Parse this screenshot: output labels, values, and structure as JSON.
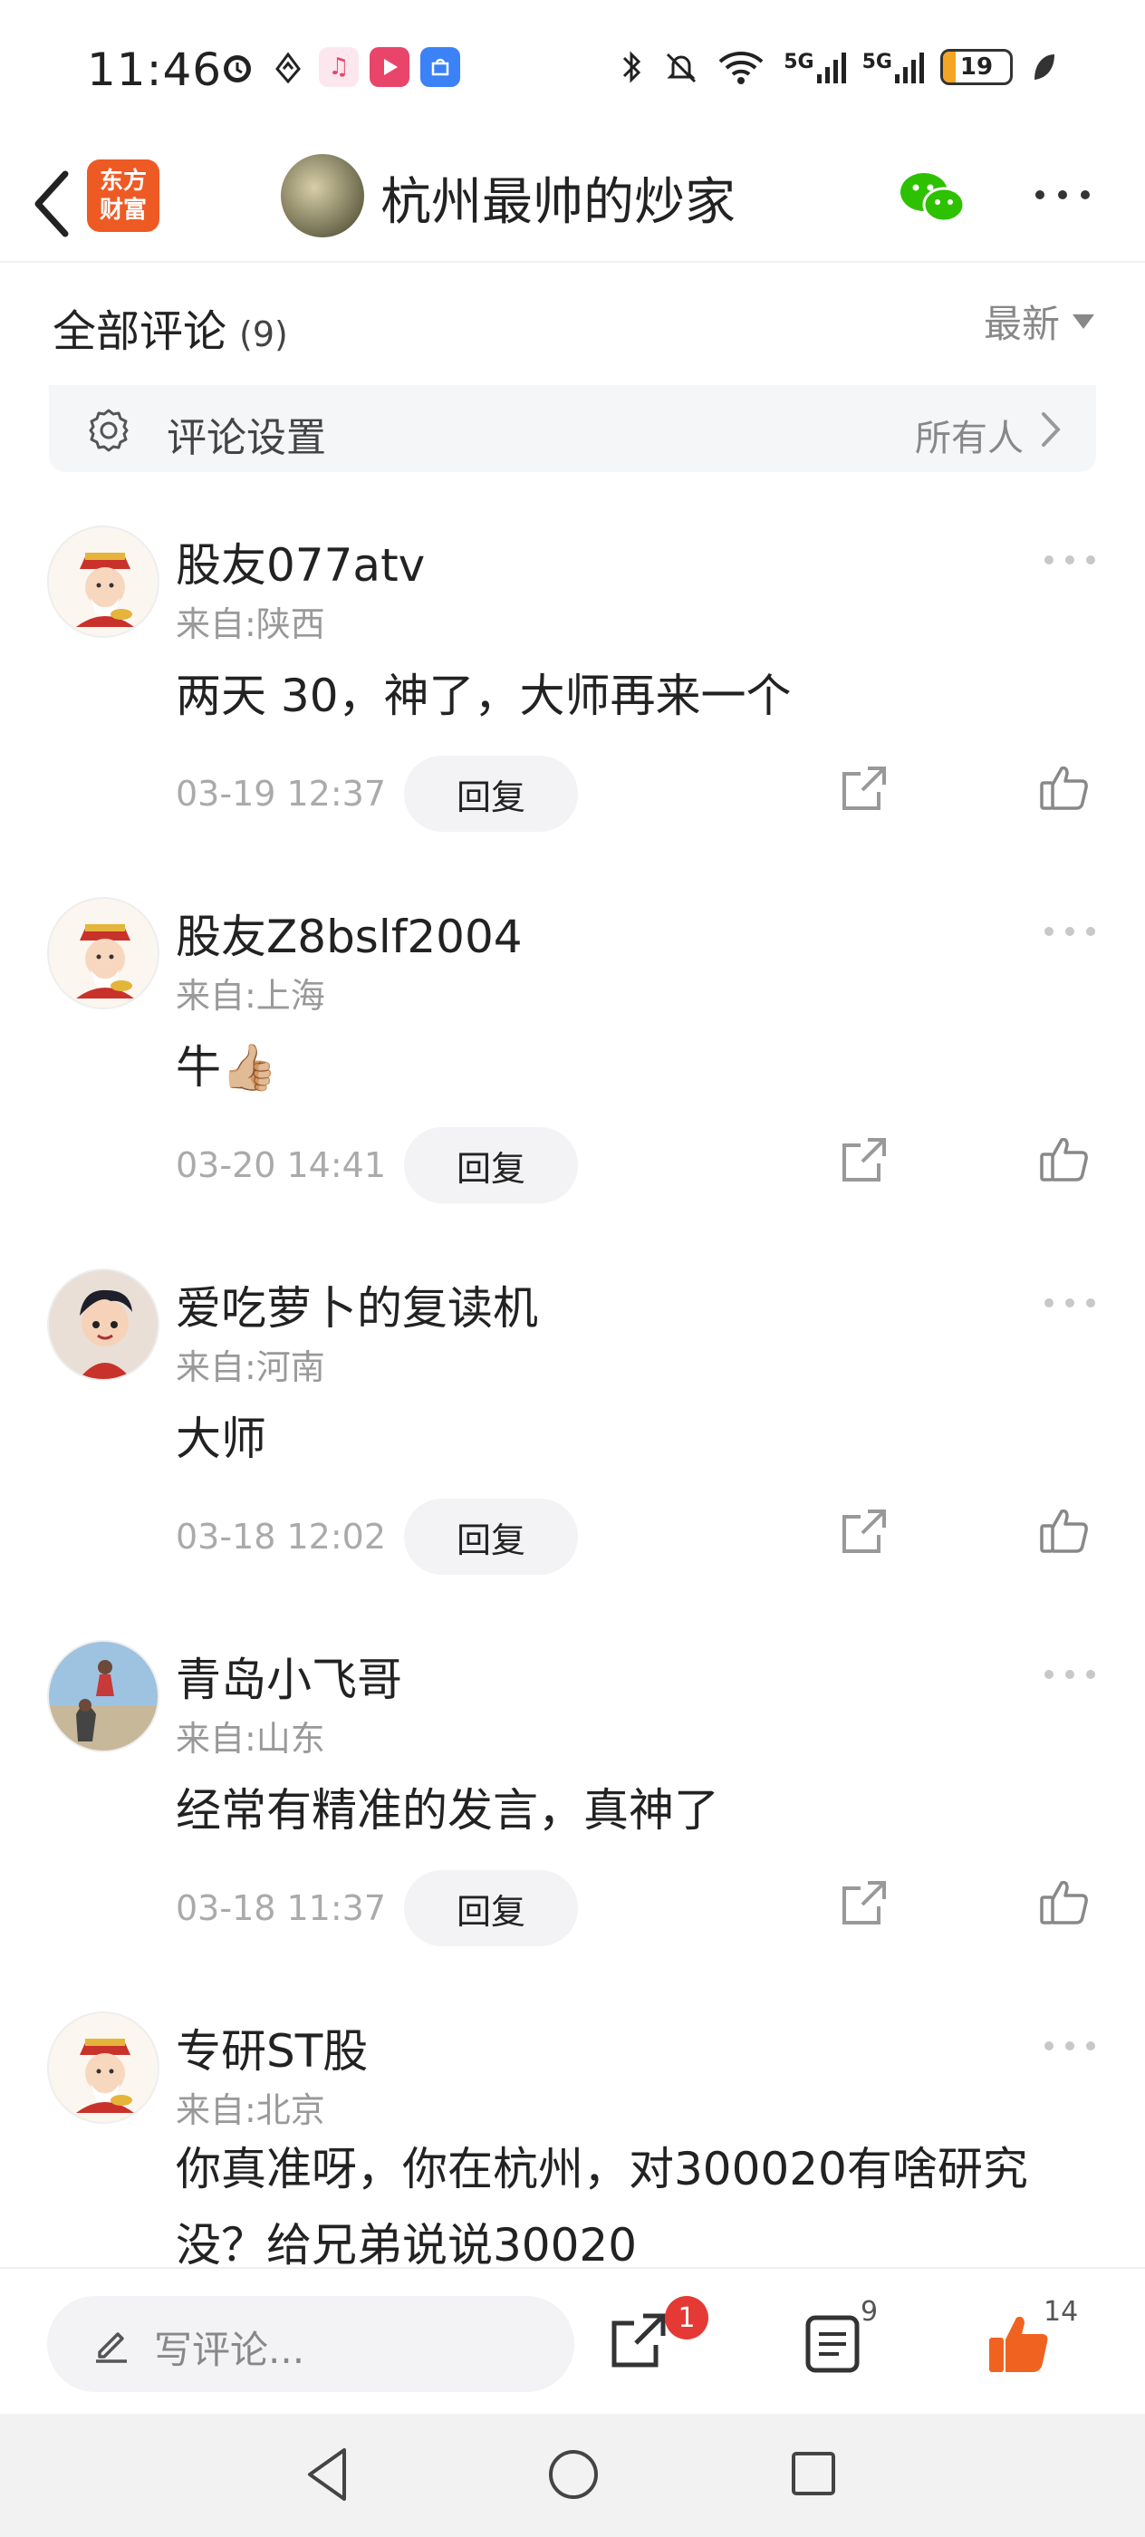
{
  "status_bar": {
    "time": "11:46",
    "battery": "19",
    "battery_level_percent": 19,
    "network_1": "5G",
    "network_2": "5G",
    "icons": [
      "alarm-icon",
      "hand-icon",
      "music-app-icon",
      "video-app-icon",
      "honor-store-icon",
      "bluetooth-icon",
      "mute-icon",
      "wifi-icon",
      "signal-icon",
      "battery-icon",
      "leaf-icon"
    ]
  },
  "header": {
    "logo_line1": "东方",
    "logo_line2": "财富",
    "title": "杭州最帅的炒家"
  },
  "comments_section": {
    "label": "全部评论",
    "count": "(9)",
    "sort": "最新"
  },
  "settings": {
    "label": "评论设置",
    "value": "所有人"
  },
  "comments": [
    {
      "user": "股友077atv",
      "location": "来自:陕西",
      "text": "两天 30，神了，大师再来一个",
      "time": "03-19 12:37",
      "reply": "回复"
    },
    {
      "user": "股友Z8bslf2004",
      "location": "来自:上海",
      "text": "牛👍🏼",
      "time": "03-20 14:41",
      "reply": "回复"
    },
    {
      "user": "爱吃萝卜的复读机",
      "location": "来自:河南",
      "text": "大师",
      "time": "03-18 12:02",
      "reply": "回复"
    },
    {
      "user": "青岛小飞哥",
      "location": "来自:山东",
      "text": "经常有精准的发言，真神了",
      "time": "03-18 11:37",
      "reply": "回复"
    },
    {
      "user": "专研ST股",
      "location": "来自:北京",
      "text": "你真准呀，你在杭州，对300020有啥研究没？给兄弟说说30020",
      "time": "",
      "reply": ""
    }
  ],
  "bottom_bar": {
    "placeholder": "写评论...",
    "share_badge": "1",
    "comments_count": "9",
    "likes_count": "14"
  },
  "colors": {
    "brand": "#ee5a24",
    "like_active": "#f0621f",
    "badge": "#e53935",
    "wechat": "#2dc100"
  }
}
